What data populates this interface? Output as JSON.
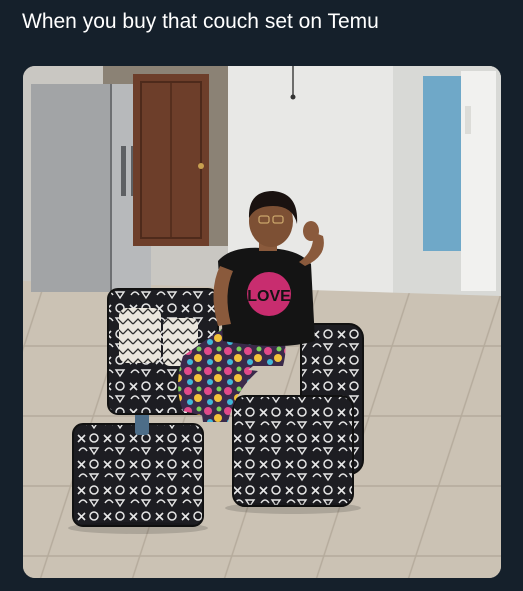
{
  "post": {
    "caption": "When you buy that couch set on Temu"
  },
  "photo": {
    "shirt_text": "LOVE"
  },
  "colors": {
    "background": "#15202b",
    "caption_text": "#ffffff",
    "shirt_print": "#e8317f"
  }
}
